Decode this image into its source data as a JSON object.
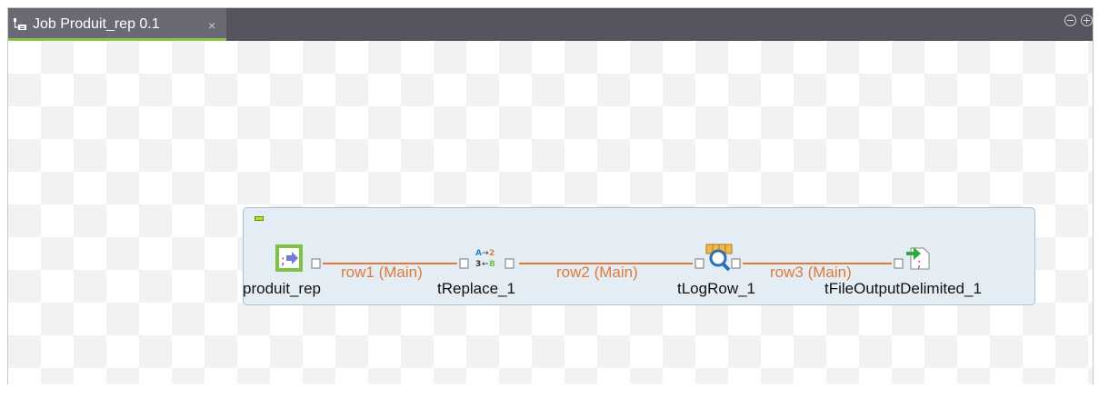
{
  "tab": {
    "title": "Job Produit_rep 0.1",
    "close": "×",
    "icon": "job-icon"
  },
  "window_controls": {
    "minimize": "−",
    "maximize": "+"
  },
  "colors": {
    "link": "#e07a3c",
    "subjob_bg": "#e4edf4",
    "tab_accent": "#8bc34a"
  },
  "components": [
    {
      "name": "produit_rep",
      "icon": "file-input-icon"
    },
    {
      "name": "tReplace_1",
      "icon": "replace-icon"
    },
    {
      "name": "tLogRow_1",
      "icon": "logrow-icon"
    },
    {
      "name": "tFileOutputDelimited_1",
      "icon": "file-output-icon"
    }
  ],
  "rows": [
    {
      "label": "row1 (Main)"
    },
    {
      "label": "row2 (Main)"
    },
    {
      "label": "row3 (Main)"
    }
  ]
}
